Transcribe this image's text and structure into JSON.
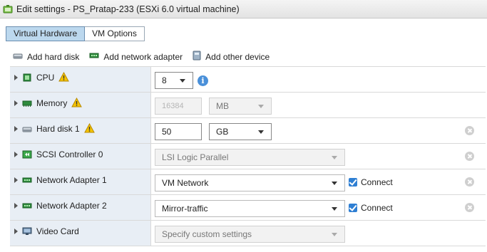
{
  "window": {
    "title": "Edit settings - PS_Pratap-233 (ESXi 6.0 virtual machine)"
  },
  "tabs": [
    {
      "label": "Virtual Hardware",
      "active": true
    },
    {
      "label": "VM Options",
      "active": false
    }
  ],
  "toolbar": {
    "add_hard_disk": "Add hard disk",
    "add_network_adapter": "Add network adapter",
    "add_other_device": "Add other device"
  },
  "devices": {
    "cpu": {
      "label": "CPU",
      "value": "8"
    },
    "memory": {
      "label": "Memory",
      "value": "16384",
      "unit": "MB"
    },
    "hard_disk": {
      "label": "Hard disk 1",
      "value": "50",
      "unit": "GB"
    },
    "scsi": {
      "label": "SCSI Controller 0",
      "value": "LSI Logic Parallel"
    },
    "net1": {
      "label": "Network Adapter 1",
      "value": "VM Network",
      "connect": "Connect"
    },
    "net2": {
      "label": "Network Adapter 2",
      "value": "Mirror-traffic",
      "connect": "Connect"
    },
    "video": {
      "label": "Video Card",
      "value": "Specify custom settings"
    }
  },
  "icons": {
    "info": "i"
  },
  "colors": {
    "accent": "#2f7fd3",
    "tab_active": "#bcd8ee",
    "row_left": "#e8eef5",
    "warning": "#f5c400"
  }
}
